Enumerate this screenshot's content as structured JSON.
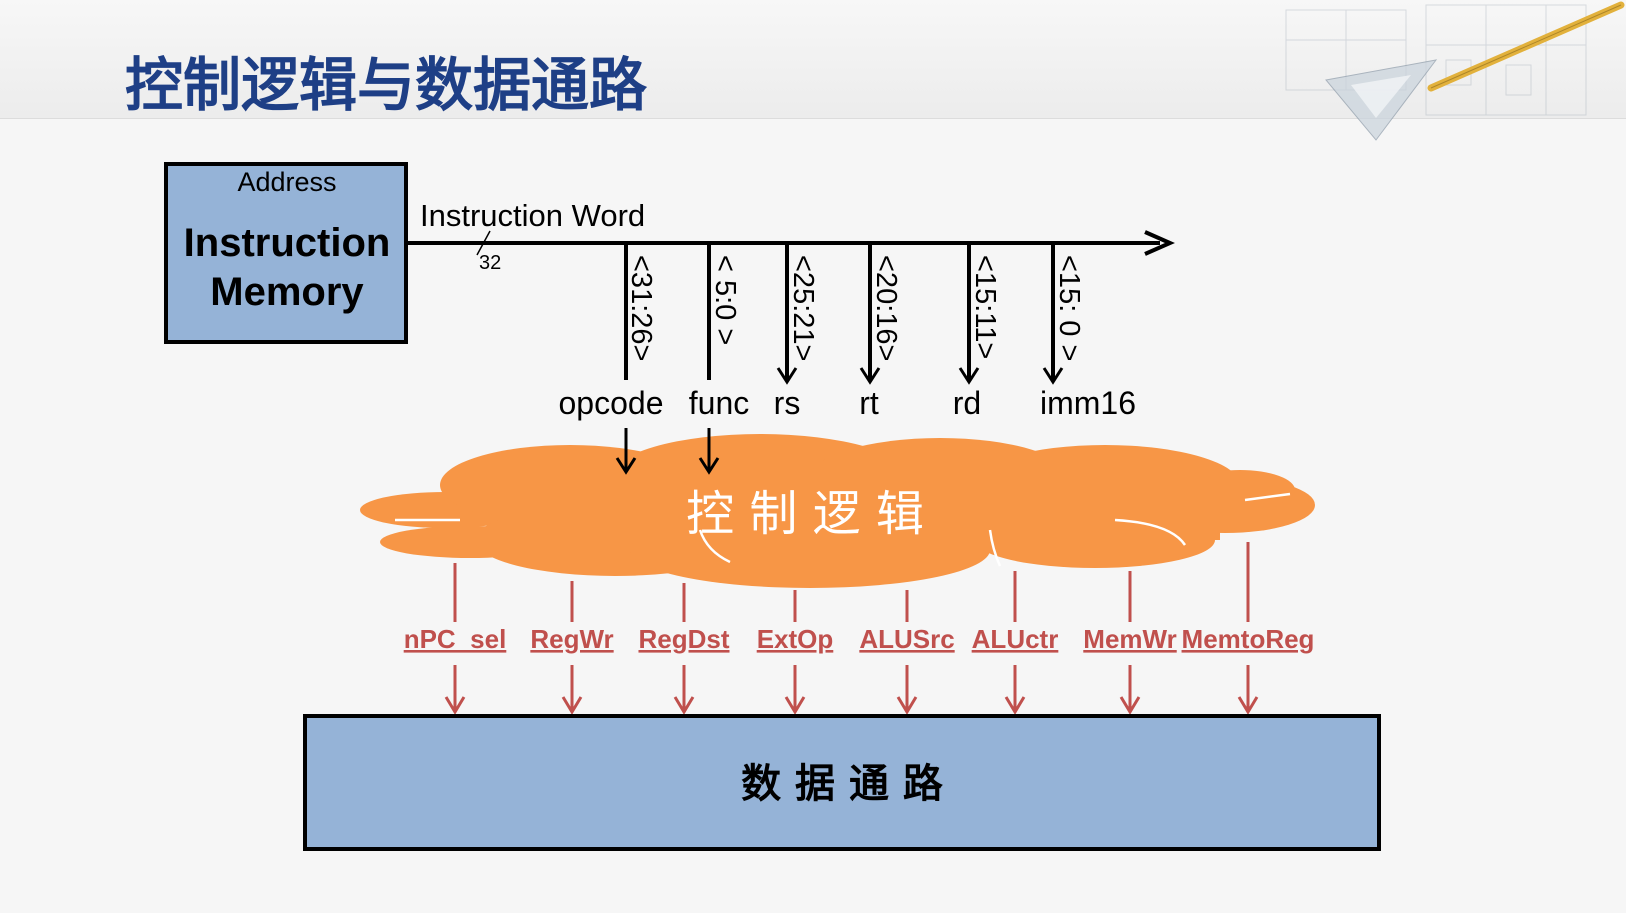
{
  "slide": {
    "title": "控制逻辑与数据通路"
  },
  "instruction_memory": {
    "address_label": "Address",
    "name_line1": "Instruction",
    "name_line2": "Memory"
  },
  "instruction_bus": {
    "label": "Instruction Word",
    "width_label": "32",
    "fields": [
      {
        "bits": "<31:26>",
        "name": "opcode"
      },
      {
        "bits": "< 5:0 >",
        "name": "func"
      },
      {
        "bits": "<25:21>",
        "name": "rs"
      },
      {
        "bits": "<20:16>",
        "name": "rt"
      },
      {
        "bits": "<15:11>",
        "name": "rd"
      },
      {
        "bits": "<15: 0 >",
        "name": "imm16"
      }
    ]
  },
  "control_logic": {
    "label": "控 制 逻 辑"
  },
  "control_signals": [
    "nPC_sel",
    "RegWr",
    "RegDst",
    "ExtOp",
    "ALUSrc",
    "ALUctr",
    "MemWr",
    "MemtoReg"
  ],
  "datapath": {
    "label": "数 据 通 路"
  },
  "colors": {
    "title": "#1e3f86",
    "memory_fill": "#95b3d7",
    "datapath_fill": "#95b3d7",
    "cloud_fill": "#f79646",
    "signal_color": "#c0504d"
  }
}
